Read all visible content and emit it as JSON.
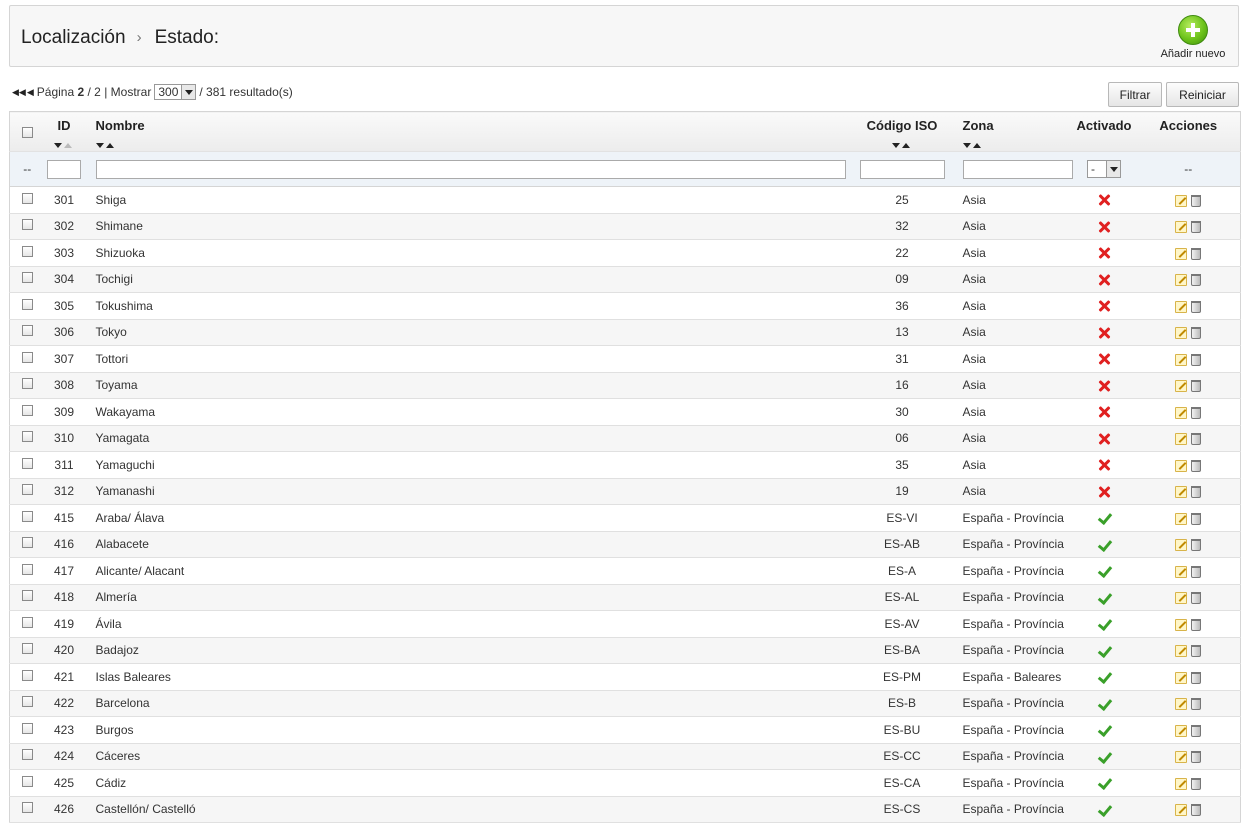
{
  "breadcrumb": {
    "section": "Localización",
    "page": "Estado:"
  },
  "toolbar": {
    "add_new_label": "Añadir nuevo"
  },
  "pagination": {
    "page_word": "Página",
    "current_page": "2",
    "total_pages": "/ 2",
    "separator": "|",
    "show_label": "Mostrar",
    "page_size": "300",
    "results_text": "/ 381 resultado(s)"
  },
  "buttons": {
    "filter": "Filtrar",
    "reset": "Reiniciar"
  },
  "columns": {
    "id": "ID",
    "name": "Nombre",
    "iso": "Código ISO",
    "zone": "Zona",
    "active": "Activado",
    "actions": "Acciones"
  },
  "filters": {
    "dash": "--",
    "active_value": "-",
    "actions_dash": "--"
  },
  "rows": [
    {
      "id": "301",
      "name": "Shiga",
      "iso": "25",
      "zone": "Asia",
      "active": false
    },
    {
      "id": "302",
      "name": "Shimane",
      "iso": "32",
      "zone": "Asia",
      "active": false
    },
    {
      "id": "303",
      "name": "Shizuoka",
      "iso": "22",
      "zone": "Asia",
      "active": false
    },
    {
      "id": "304",
      "name": "Tochigi",
      "iso": "09",
      "zone": "Asia",
      "active": false
    },
    {
      "id": "305",
      "name": "Tokushima",
      "iso": "36",
      "zone": "Asia",
      "active": false
    },
    {
      "id": "306",
      "name": "Tokyo",
      "iso": "13",
      "zone": "Asia",
      "active": false
    },
    {
      "id": "307",
      "name": "Tottori",
      "iso": "31",
      "zone": "Asia",
      "active": false
    },
    {
      "id": "308",
      "name": "Toyama",
      "iso": "16",
      "zone": "Asia",
      "active": false
    },
    {
      "id": "309",
      "name": "Wakayama",
      "iso": "30",
      "zone": "Asia",
      "active": false
    },
    {
      "id": "310",
      "name": "Yamagata",
      "iso": "06",
      "zone": "Asia",
      "active": false
    },
    {
      "id": "311",
      "name": "Yamaguchi",
      "iso": "35",
      "zone": "Asia",
      "active": false
    },
    {
      "id": "312",
      "name": "Yamanashi",
      "iso": "19",
      "zone": "Asia",
      "active": false
    },
    {
      "id": "415",
      "name": "Araba/ Álava",
      "iso": "ES-VI",
      "zone": "España - Província",
      "active": true
    },
    {
      "id": "416",
      "name": "Alabacete",
      "iso": "ES-AB",
      "zone": "España - Província",
      "active": true
    },
    {
      "id": "417",
      "name": "Alicante/ Alacant",
      "iso": "ES-A",
      "zone": "España - Província",
      "active": true
    },
    {
      "id": "418",
      "name": "Almería",
      "iso": "ES-AL",
      "zone": "España - Província",
      "active": true
    },
    {
      "id": "419",
      "name": "Ávila",
      "iso": "ES-AV",
      "zone": "España - Província",
      "active": true
    },
    {
      "id": "420",
      "name": "Badajoz",
      "iso": "ES-BA",
      "zone": "España - Província",
      "active": true
    },
    {
      "id": "421",
      "name": "Islas Baleares",
      "iso": "ES-PM",
      "zone": "España - Baleares",
      "active": true
    },
    {
      "id": "422",
      "name": "Barcelona",
      "iso": "ES-B",
      "zone": "España - Província",
      "active": true
    },
    {
      "id": "423",
      "name": "Burgos",
      "iso": "ES-BU",
      "zone": "España - Província",
      "active": true
    },
    {
      "id": "424",
      "name": "Cáceres",
      "iso": "ES-CC",
      "zone": "España - Província",
      "active": true
    },
    {
      "id": "425",
      "name": "Cádiz",
      "iso": "ES-CA",
      "zone": "España - Província",
      "active": true
    },
    {
      "id": "426",
      "name": "Castellón/ Castelló",
      "iso": "ES-CS",
      "zone": "España - Província",
      "active": true
    }
  ],
  "icons": {
    "inactive": "red-x-icon",
    "active": "green-check-icon",
    "edit": "pencil-icon",
    "delete": "trash-icon",
    "add": "green-plus-icon"
  },
  "colors": {
    "inactive": "#e02020",
    "active": "#3aa02a",
    "add_button": "#6cc21a"
  }
}
